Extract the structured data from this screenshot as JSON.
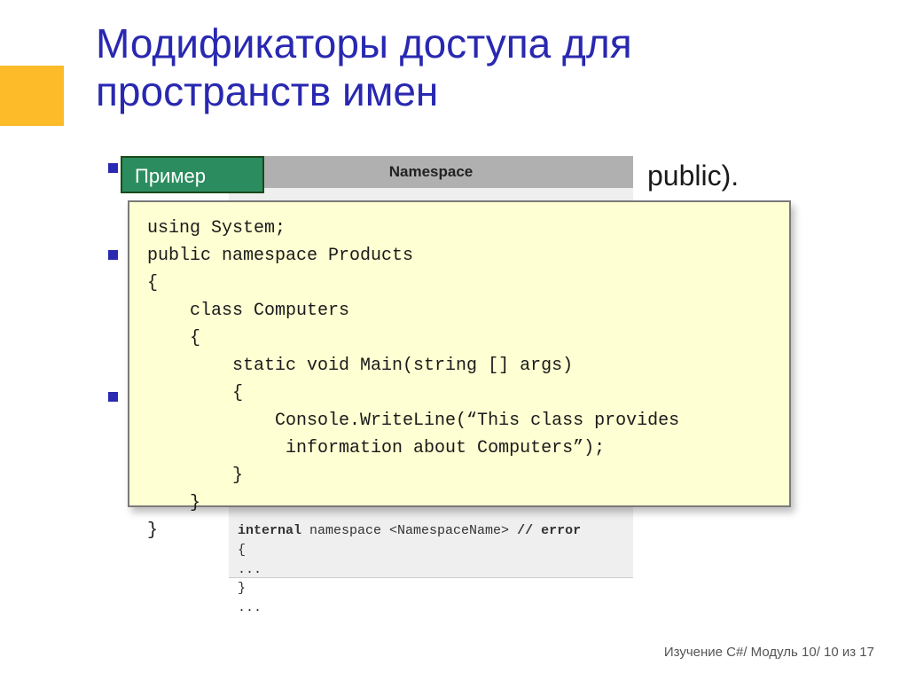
{
  "slide": {
    "title": "Модификаторы доступа для пространств имен",
    "visible_right_text": "public).",
    "example_label": "Пример",
    "bg_panel_header": "Namespace",
    "bg_code_html": "<b>internal</b> namespace &lt;NamespaceName&gt; <b>// error</b>\n{\n...\n}\n...",
    "code": "using System;\npublic namespace Products\n{\n    class Computers\n    {\n        static void Main(string [] args)\n        {\n            Console.WriteLine(“This class provides\n             information about Computers”);\n        }\n    }\n}",
    "footer": "Изучение C#/ Модуль 10/ 10 из 17"
  }
}
